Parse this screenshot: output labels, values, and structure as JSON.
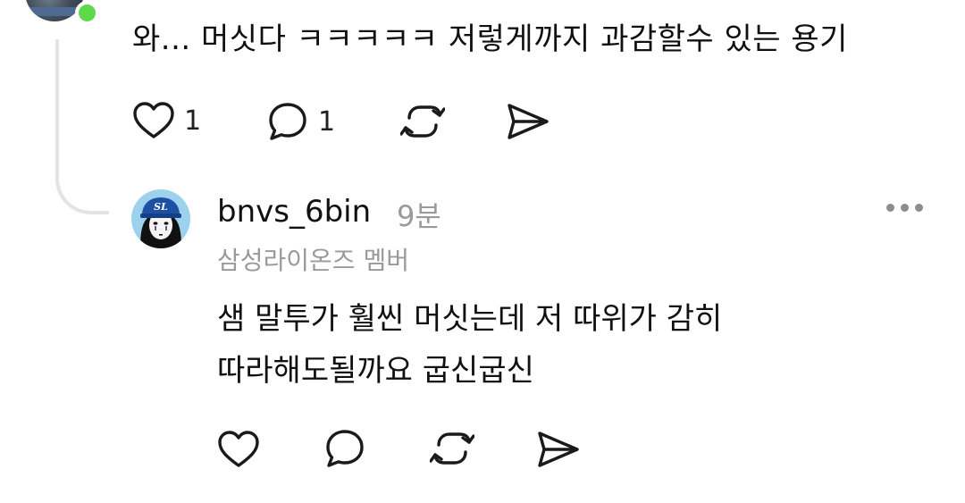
{
  "parent_comment": {
    "text": "와... 머싯다 ㅋㅋㅋㅋㅋ 저렇게까지 과감할수 있는 용기",
    "like_count": "1",
    "reply_count": "1",
    "status": "online"
  },
  "reply": {
    "username": "bnvs_6bin",
    "time": "9분",
    "membership": "삼성라이온즈 멤버",
    "text_lines": [
      "샘 말투가 훨씬 머싯는데 저 따위가 감히",
      "따라해도될까요 굽신굽신"
    ],
    "avatar_cap_text": "SL"
  },
  "icons": {
    "like": "heart-icon",
    "reply": "comment-bubble-icon",
    "repost": "repost-icon",
    "share": "send-icon",
    "more": "more-horizontal-icon"
  },
  "colors": {
    "online": "#5fd94a",
    "muted_text": "#9a9a9a",
    "thread_line": "#e3e3e3",
    "avatar_bg": "#9dd2ef",
    "cap": "#1d4fa3"
  }
}
